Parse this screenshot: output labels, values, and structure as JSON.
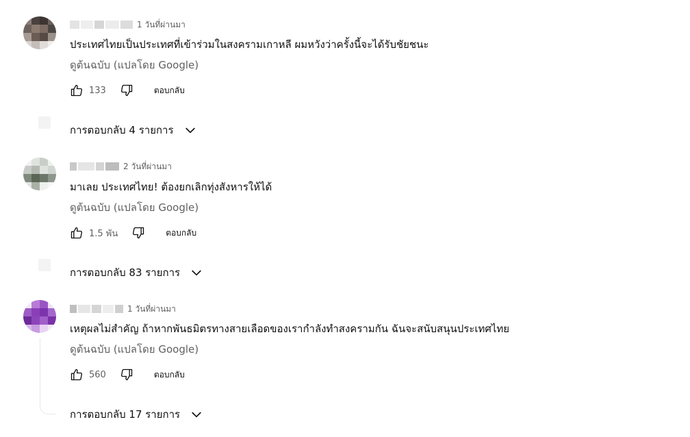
{
  "comments": [
    {
      "time": "1 วันที่ผ่านมา",
      "text": "ประเทศไทยเป็นประเทศที่เข้าร่วมในสงครามเกาหลี ผมหวังว่าครั้งนี้จะได้รับชัยชนะ",
      "translate_label": "ดูต้นฉบับ (แปลโดย Google)",
      "likes": "133",
      "reply_label": "ตอบกลับ",
      "replies_label": "การตอบกลับ 4 รายการ",
      "avatar_colors": [
        "#6e625c",
        "#4d4743",
        "#8b7a70",
        "#3a3431"
      ]
    },
    {
      "time": "2 วันที่ผ่านมา",
      "text": "มาเลย ประเทศไทย! ต้องยกเลิกทุ่งสังหารให้ได้",
      "translate_label": "ดูต้นฉบับ (แปลโดย Google)",
      "likes": "1.5 พัน",
      "reply_label": "ตอบกลับ",
      "replies_label": "การตอบกลับ 83 รายการ",
      "avatar_colors": [
        "#c9cfc8",
        "#7f8a7d",
        "#5b6657",
        "#e2e6e1"
      ]
    },
    {
      "time": "1 วันที่ผ่านมา",
      "text": "เหตุผลไม่สำคัญ ถ้าหากพันธมิตรทางสายเลือดของเรากำลังทำสงครามกัน ฉันจะสนับสนุนประเทศไทย",
      "translate_label": "ดูต้นฉบับ (แปลโดย Google)",
      "likes": "560",
      "reply_label": "ตอบกลับ",
      "replies_label": "การตอบกลับ 17 รายการ",
      "avatar_colors": [
        "#8a3fb8",
        "#b77bd6",
        "#6d2a99",
        "#d9b8ec"
      ]
    }
  ],
  "icons": {
    "like": "thumb-up-icon",
    "dislike": "thumb-down-icon",
    "expand": "chevron-down-icon"
  }
}
